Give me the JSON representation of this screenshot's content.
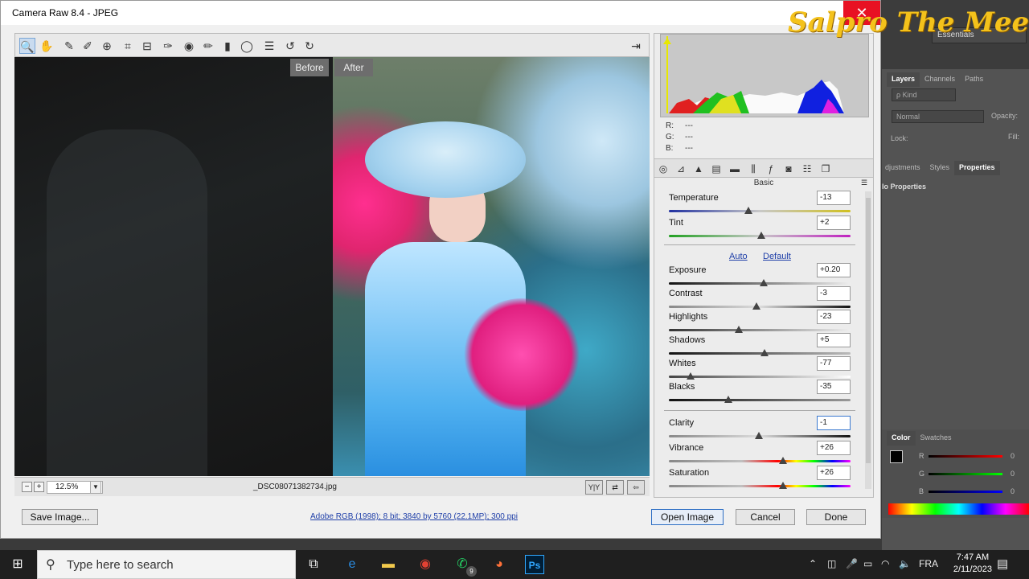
{
  "window": {
    "title": "Camera Raw 8.4  -  JPEG",
    "close_glyph": "✕"
  },
  "watermark": "Salpro The Meek",
  "photoshop": {
    "workspace": "Essentials",
    "panel_tabs_1": [
      "Layers",
      "Channels",
      "Paths"
    ],
    "kind_field": "ρ Kind",
    "blend_mode": "Normal",
    "opacity_label": "Opacity:",
    "lock_label": "Lock:",
    "fill_label": "Fill:",
    "panel_tabs_2": [
      "djustments",
      "Styles",
      "Properties"
    ],
    "properties_text": "lo Properties",
    "color_tabs": [
      "Color",
      "Swatches"
    ],
    "rgb_labels": [
      "R",
      "G",
      "B"
    ],
    "rgb_values": [
      "0",
      "0",
      "0"
    ]
  },
  "toolbar": {
    "tools": [
      "zoom-tool",
      "hand-tool",
      "white-balance-tool",
      "color-sampler-tool",
      "targeted-adjustment-tool",
      "crop-tool",
      "straighten-tool",
      "spot-removal-tool",
      "red-eye-removal-tool",
      "adjustment-brush",
      "graduated-filter",
      "radial-filter",
      "preferences",
      "rotate-ccw",
      "rotate-cw"
    ]
  },
  "preview": {
    "before_label": "Before",
    "after_label": "After"
  },
  "status": {
    "zoom": "12.5%",
    "filename": "_DSC08071382734.jpg",
    "view_buttons": [
      "Y|Y",
      "⇄",
      "⇦"
    ]
  },
  "histogram": {
    "r_label": "R:",
    "g_label": "G:",
    "b_label": "B:",
    "r_value": "---",
    "g_value": "---",
    "b_value": "---"
  },
  "panel": {
    "title": "Basic",
    "auto_label": "Auto",
    "default_label": "Default",
    "sliders": [
      {
        "label": "Temperature",
        "value": "-13"
      },
      {
        "label": "Tint",
        "value": "+2"
      },
      {
        "label": "Exposure",
        "value": "+0.20"
      },
      {
        "label": "Contrast",
        "value": "-3"
      },
      {
        "label": "Highlights",
        "value": "-23"
      },
      {
        "label": "Shadows",
        "value": "+5"
      },
      {
        "label": "Whites",
        "value": "-77"
      },
      {
        "label": "Blacks",
        "value": "-35"
      },
      {
        "label": "Clarity",
        "value": "-1"
      },
      {
        "label": "Vibrance",
        "value": "+26"
      },
      {
        "label": "Saturation",
        "value": "+26"
      }
    ]
  },
  "buttons": {
    "save_image": "Save Image...",
    "open_image": "Open Image",
    "cancel": "Cancel",
    "done": "Done"
  },
  "info_link": "Adobe RGB (1998); 8 bit; 3840 by 5760 (22.1MP); 300 ppi",
  "taskbar": {
    "search_placeholder": "Type here to search",
    "language": "FRA",
    "time": "7:47 AM",
    "date": "2/11/2023",
    "whatsapp_badge": "9"
  }
}
